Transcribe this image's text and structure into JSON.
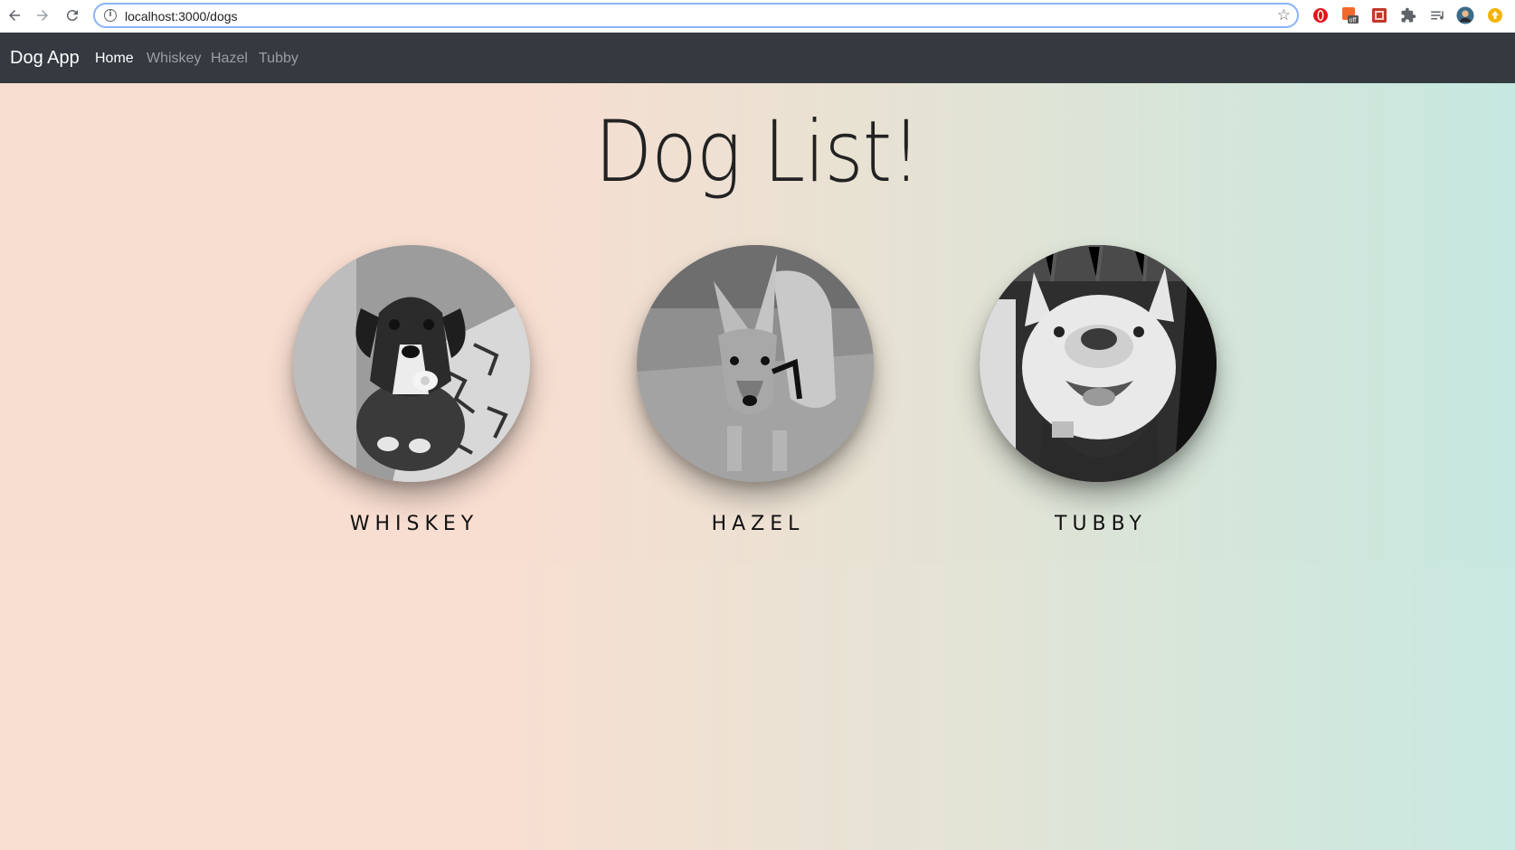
{
  "browser": {
    "url": "localhost:3000/dogs",
    "icons": [
      "back-arrow-icon",
      "forward-arrow-icon",
      "reload-icon",
      "info-icon",
      "bookmark-star-icon",
      "extension-opera-icon",
      "extension-off-icon",
      "extension-red-icon",
      "extensions-puzzle-icon",
      "reading-list-icon",
      "profile-avatar-icon",
      "update-icon"
    ]
  },
  "navbar": {
    "brand": "Dog App",
    "links": [
      {
        "label": "Home",
        "active": true
      },
      {
        "label": "Whiskey",
        "active": false
      },
      {
        "label": "Hazel",
        "active": false
      },
      {
        "label": "Tubby",
        "active": false
      }
    ]
  },
  "main": {
    "title": "Dog List!",
    "dogs": [
      {
        "name": "WHISKEY"
      },
      {
        "name": "HAZEL"
      },
      {
        "name": "TUBBY"
      }
    ]
  },
  "colors": {
    "navbar_bg": "#343a40",
    "gradient_left": "#f8ded1",
    "gradient_right": "#c6e8e0",
    "address_focus": "#8ab4f8"
  }
}
